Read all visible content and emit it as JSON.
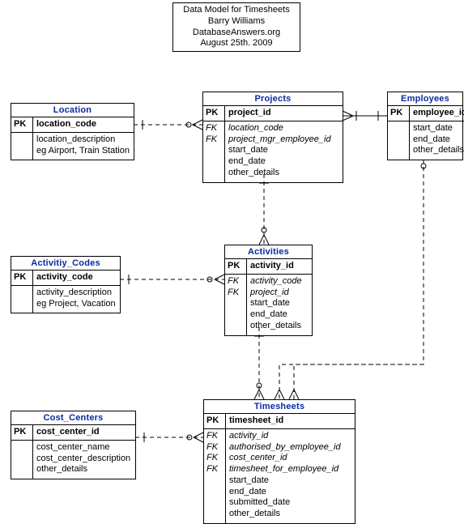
{
  "header": {
    "line1": "Data Model for Timesheets",
    "line2": "Barry Williams",
    "line3": "DatabaseAnswers.org",
    "line4": "August 25th. 2009"
  },
  "entities": {
    "location": {
      "title": "Location",
      "pk_label": "PK",
      "pk": "location_code",
      "attrs": [
        "location_description",
        "eg Airport, Train Station"
      ]
    },
    "projects": {
      "title": "Projects",
      "pk_label": "PK",
      "pk": "project_id",
      "fk_label": "FK",
      "rows": [
        {
          "k": "FK",
          "v": "location_code"
        },
        {
          "k": "FK",
          "v": "project_mgr_employee_id"
        },
        {
          "k": "",
          "v": "start_date"
        },
        {
          "k": "",
          "v": "end_date"
        },
        {
          "k": "",
          "v": "other_details"
        }
      ]
    },
    "employees": {
      "title": "Employees",
      "pk_label": "PK",
      "pk": "employee_id",
      "attrs": [
        "start_date",
        "end_date",
        "other_details"
      ]
    },
    "activity_codes": {
      "title": "Activitiy_Codes",
      "pk_label": "PK",
      "pk": "activity_code",
      "attrs": [
        "activity_description",
        "eg Project, Vacation"
      ]
    },
    "activities": {
      "title": "Activities",
      "pk_label": "PK",
      "pk": "activity_id",
      "rows": [
        {
          "k": "FK",
          "v": "activity_code"
        },
        {
          "k": "FK",
          "v": "project_id"
        },
        {
          "k": "",
          "v": "start_date"
        },
        {
          "k": "",
          "v": "end_date"
        },
        {
          "k": "",
          "v": "other_details"
        }
      ]
    },
    "cost_centers": {
      "title": "Cost_Centers",
      "pk_label": "PK",
      "pk": "cost_center_id",
      "attrs": [
        "cost_center_name",
        "cost_center_description",
        "other_details"
      ]
    },
    "timesheets": {
      "title": "Timesheets",
      "pk_label": "PK",
      "pk": "timesheet_id",
      "rows": [
        {
          "k": "FK",
          "v": "activity_id"
        },
        {
          "k": "FK",
          "v": "authorised_by_employee_id"
        },
        {
          "k": "FK",
          "v": "cost_center_id"
        },
        {
          "k": "FK",
          "v": "timesheet_for_employee_id"
        },
        {
          "k": "",
          "v": "start_date"
        },
        {
          "k": "",
          "v": "end_date"
        },
        {
          "k": "",
          "v": "submitted_date"
        },
        {
          "k": "",
          "v": "other_details"
        }
      ]
    }
  },
  "relationships": [
    {
      "from": "Location",
      "to": "Projects",
      "type": "one-to-many-dashed"
    },
    {
      "from": "Employees",
      "to": "Projects",
      "type": "one-to-many-solid"
    },
    {
      "from": "Projects",
      "to": "Activities",
      "type": "one-to-many-dashed"
    },
    {
      "from": "Activitiy_Codes",
      "to": "Activities",
      "type": "one-to-many-dashed"
    },
    {
      "from": "Activities",
      "to": "Timesheets",
      "type": "one-to-many-dashed"
    },
    {
      "from": "Cost_Centers",
      "to": "Timesheets",
      "type": "one-to-many-dashed"
    },
    {
      "from": "Employees",
      "to": "Timesheets",
      "type": "one-to-many-dashed-two"
    }
  ]
}
